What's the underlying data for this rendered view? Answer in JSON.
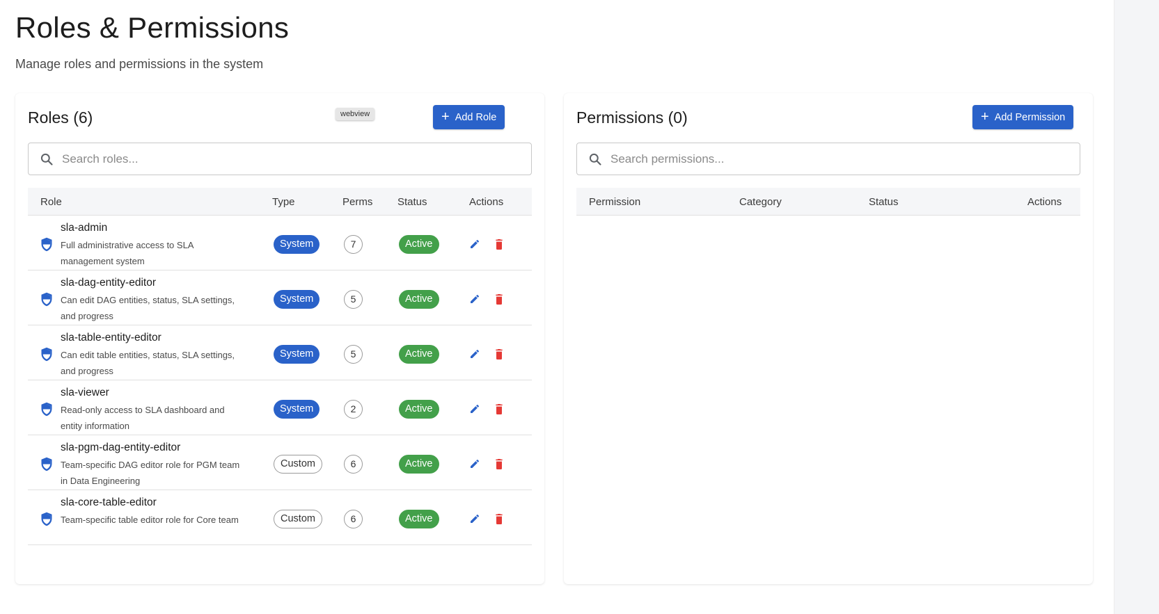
{
  "page": {
    "title": "Roles & Permissions",
    "subtitle": "Manage roles and permissions in the system"
  },
  "roles_panel": {
    "title": "Roles (6)",
    "add_button": "Add Role",
    "webview_tag": "webview",
    "search_placeholder": "Search roles...",
    "columns": [
      "Role",
      "Type",
      "Perms",
      "Status",
      "Actions"
    ],
    "rows": [
      {
        "name": "sla-admin",
        "description": "Full administrative access to SLA management system",
        "type": "System",
        "perms": "7",
        "status": "Active"
      },
      {
        "name": "sla-dag-entity-editor",
        "description": "Can edit DAG entities, status, SLA settings, and progress",
        "type": "System",
        "perms": "5",
        "status": "Active"
      },
      {
        "name": "sla-table-entity-editor",
        "description": "Can edit table entities, status, SLA settings, and progress",
        "type": "System",
        "perms": "5",
        "status": "Active"
      },
      {
        "name": "sla-viewer",
        "description": "Read-only access to SLA dashboard and entity information",
        "type": "System",
        "perms": "2",
        "status": "Active"
      },
      {
        "name": "sla-pgm-dag-entity-editor",
        "description": "Team-specific DAG editor role for PGM team in Data Engineering",
        "type": "Custom",
        "perms": "6",
        "status": "Active"
      },
      {
        "name": "sla-core-table-editor",
        "description": "Team-specific table editor role for Core team",
        "type": "Custom",
        "perms": "6",
        "status": "Active"
      }
    ]
  },
  "permissions_panel": {
    "title": "Permissions (0)",
    "add_button": "Add Permission",
    "search_placeholder": "Search permissions...",
    "columns": [
      "Permission",
      "Category",
      "Status",
      "Actions"
    ]
  },
  "colors": {
    "primary": "#2a62c9",
    "active": "#43a04a",
    "delete": "#e53935"
  },
  "icons": {
    "search": "search-icon",
    "role": "shield-icon",
    "edit": "pencil-icon",
    "delete": "trash-icon",
    "add": "plus-icon"
  }
}
